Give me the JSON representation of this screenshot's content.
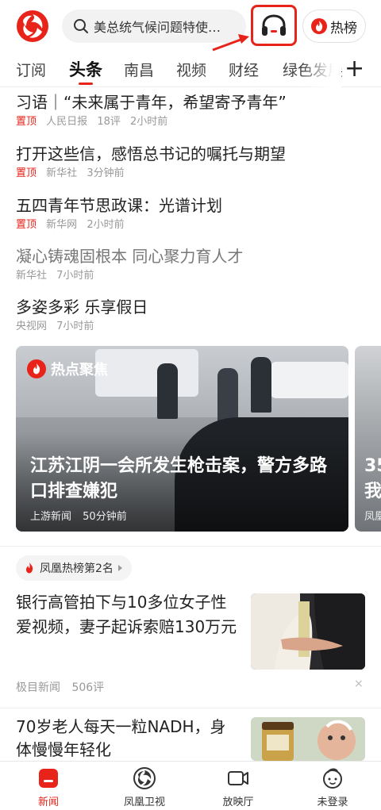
{
  "header": {
    "search_placeholder": "美总统气候问题特使…",
    "hot_label": "热榜",
    "icons": {
      "logo": "phoenix-logo-icon",
      "search": "search-icon",
      "listen": "headphones-icon",
      "hot": "flame-icon"
    },
    "accent": "#e8231a"
  },
  "tabs": [
    {
      "label": "订阅"
    },
    {
      "label": "头条",
      "active": true
    },
    {
      "label": "南昌"
    },
    {
      "label": "视频"
    },
    {
      "label": "财经"
    },
    {
      "label": "绿色发展"
    }
  ],
  "tabs_more": "+",
  "news": [
    {
      "title": "习语｜“未来属于青年，希望寄予青年”",
      "pin": "置顶",
      "source": "人民日报",
      "comments": "18评",
      "time": "2小时前"
    },
    {
      "title": "打开这些信，感悟总书记的嘱托与期望",
      "pin": "置顶",
      "source": "新华社",
      "time": "3分钟前"
    },
    {
      "title": "五四青年节思政课：光谱计划",
      "pin": "置顶",
      "source": "新华网",
      "time": "2小时前"
    },
    {
      "title": "凝心铸魂固根本 同心聚力育人才",
      "source": "新华社",
      "time": "7小时前"
    },
    {
      "title": "多姿多彩 乐享假日",
      "source": "央视网",
      "time": "7小时前"
    }
  ],
  "hot_focus": {
    "badge": "热点聚焦",
    "title": "江苏江阴一会所发生枪击案，警方多路口排查嫌犯",
    "source": "上游新闻",
    "time": "50分钟前",
    "next_title_partial": "35\n我",
    "next_source_partial": "凤凰"
  },
  "rank": {
    "label": "凤凰热榜第2名",
    "article_title": "银行高管拍下与10多位女子性爱视频，妻子起诉索赔130万元",
    "source": "极目新闻",
    "comments": "506评",
    "dismiss": "×"
  },
  "next_article": {
    "title": "70岁老人每天一粒NADH，身体慢慢年轻化"
  },
  "bottom_nav": [
    {
      "label": "新闻",
      "icon": "news-icon",
      "active": true
    },
    {
      "label": "凤凰卫视",
      "icon": "phoenix-tv-icon"
    },
    {
      "label": "放映厅",
      "icon": "video-camera-icon"
    },
    {
      "label": "未登录",
      "icon": "user-avatar-icon"
    }
  ]
}
